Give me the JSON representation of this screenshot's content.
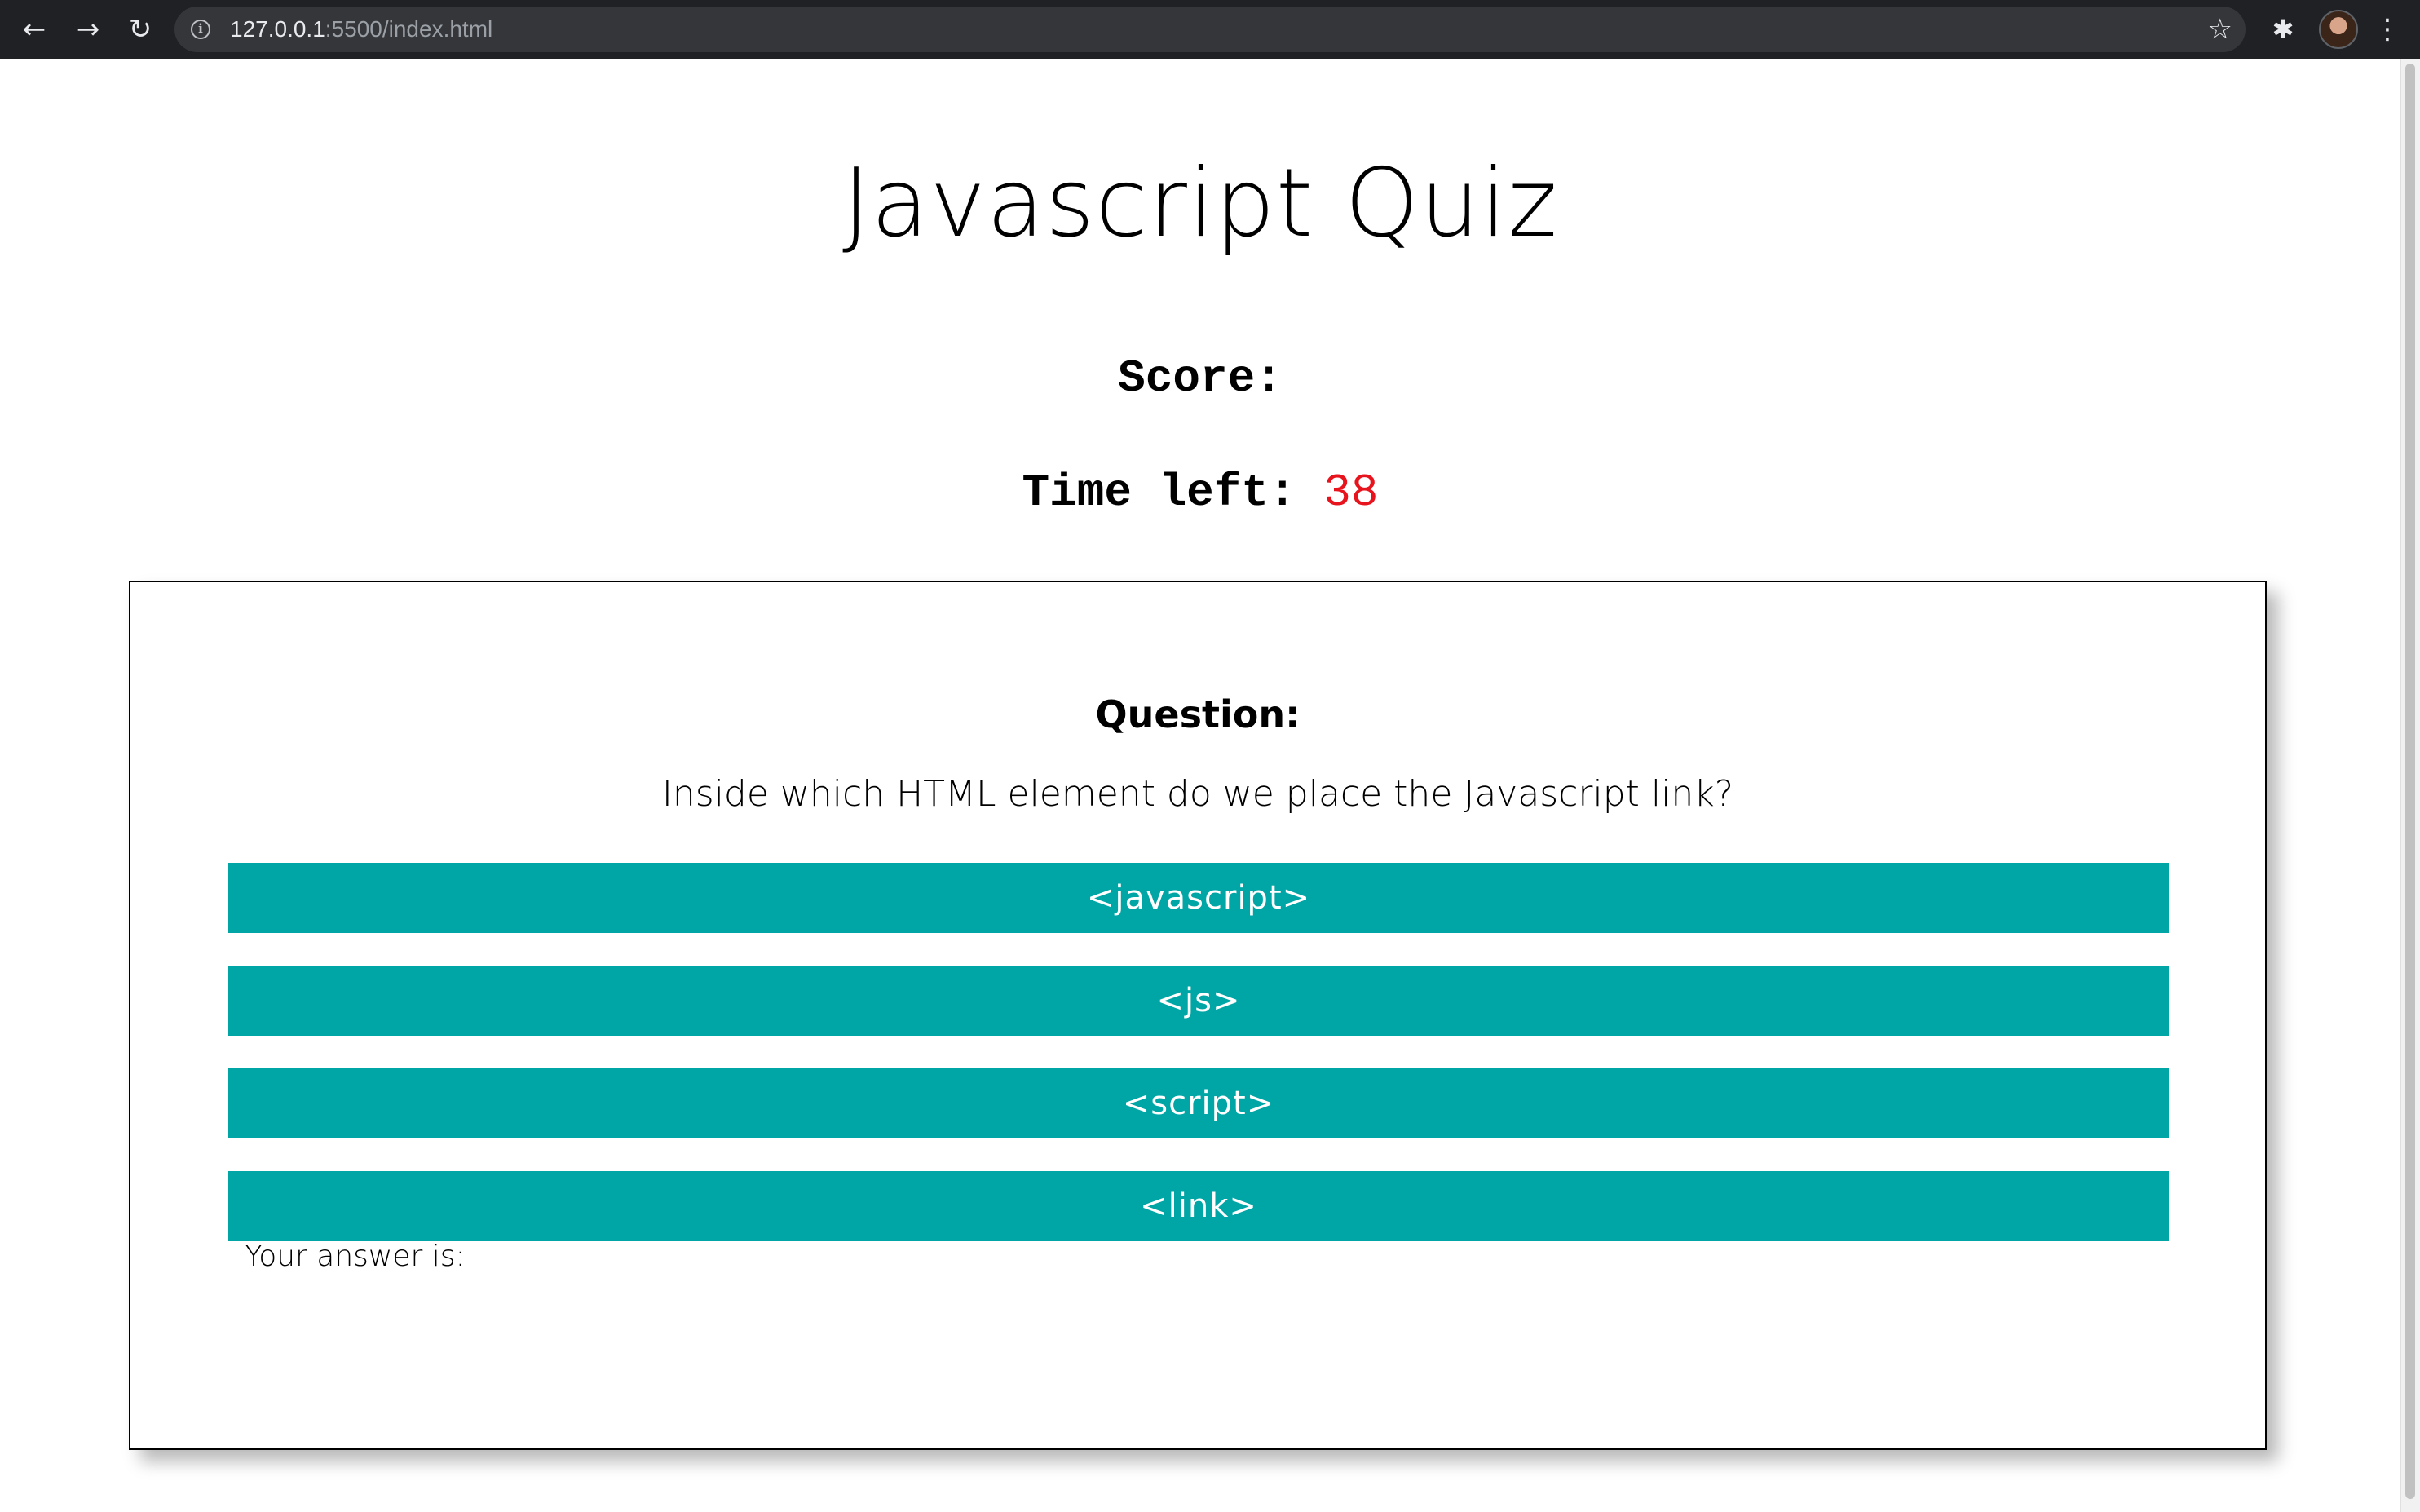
{
  "browser": {
    "url_host": "127.0.0.1",
    "url_path": ":5500/index.html",
    "back_icon": "←",
    "forward_icon": "→",
    "reload_icon": "↻",
    "info_icon": "i",
    "star_icon": "☆",
    "extensions_icon": "✱",
    "menu_icon": "⋮"
  },
  "page": {
    "title": "Javascript Quiz",
    "score_label": "Score:",
    "time_label": "Time left:",
    "time_value": "38",
    "time_color": "#e8141d"
  },
  "quiz": {
    "question_heading": "Question:",
    "question_text": "Inside which HTML element do we place the Javascript link?",
    "answers": [
      "<javascript>",
      "<js>",
      "<script>",
      "<link>"
    ],
    "answer_color": "#00a5a5",
    "your_answer_label": "Your answer is:"
  }
}
